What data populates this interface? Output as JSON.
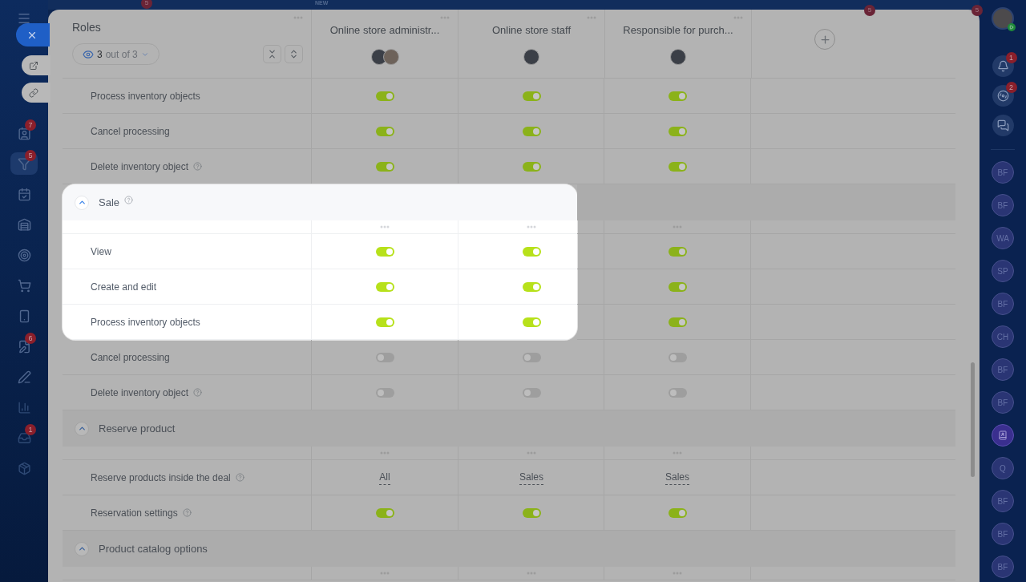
{
  "top_bar": {
    "left_badge": "5",
    "new_label": "NEW",
    "right_badges": [
      "5",
      "5"
    ]
  },
  "left_nav": {
    "items": [
      {
        "kind": "contacts",
        "badge": "7",
        "selected": false
      },
      {
        "kind": "funnel",
        "badge": "5",
        "selected": true
      },
      {
        "kind": "calendar",
        "selected": false
      },
      {
        "kind": "store",
        "selected": false
      },
      {
        "kind": "target",
        "selected": false
      },
      {
        "kind": "cart",
        "selected": false
      },
      {
        "kind": "device",
        "selected": false
      },
      {
        "kind": "document",
        "badge": "6",
        "selected": false
      },
      {
        "kind": "pen",
        "selected": false
      },
      {
        "kind": "chart",
        "selected": false
      },
      {
        "kind": "inbox",
        "badge": "1",
        "selected": false
      },
      {
        "kind": "box",
        "selected": false
      }
    ]
  },
  "right_sidebar": {
    "notifications_badge": "1",
    "activity_badge": "2",
    "contacts": [
      {
        "kind": "initials",
        "text": "BF"
      },
      {
        "kind": "initials",
        "text": "BF"
      },
      {
        "kind": "initials",
        "text": "WA"
      },
      {
        "kind": "initials",
        "text": "SP"
      },
      {
        "kind": "initials",
        "text": "BF"
      },
      {
        "kind": "initials",
        "text": "CH"
      },
      {
        "kind": "initials",
        "text": "BF"
      },
      {
        "kind": "initials",
        "text": "BF"
      },
      {
        "kind": "book"
      },
      {
        "kind": "initials",
        "text": "Q"
      },
      {
        "kind": "initials",
        "text": "BF"
      },
      {
        "kind": "initials",
        "text": "BF"
      },
      {
        "kind": "initials",
        "text": "BF"
      }
    ]
  },
  "roles_header": {
    "title": "Roles",
    "filter": {
      "shown": "3",
      "total": "out of 3"
    }
  },
  "roles": [
    {
      "name": "Online store administr...",
      "avatars": [
        {
          "kind": "photo"
        },
        {
          "kind": "photo"
        }
      ]
    },
    {
      "name": "Online store staff",
      "avatars": [
        {
          "kind": "photo"
        }
      ]
    },
    {
      "name": "Responsible for purch...",
      "avatars": [
        {
          "kind": "photo"
        }
      ]
    }
  ],
  "sections": [
    {
      "rows": [
        {
          "label": "Process inventory objects",
          "help": false,
          "highlighted": false,
          "cells": [
            {
              "kind": "toggle",
              "on": true
            },
            {
              "kind": "toggle",
              "on": true
            },
            {
              "kind": "toggle",
              "on": true
            }
          ]
        },
        {
          "label": "Cancel processing",
          "help": false,
          "highlighted": false,
          "cells": [
            {
              "kind": "toggle",
              "on": true
            },
            {
              "kind": "toggle",
              "on": true
            },
            {
              "kind": "toggle",
              "on": true
            }
          ]
        },
        {
          "label": "Delete inventory object",
          "help": true,
          "highlighted": false,
          "cells": [
            {
              "kind": "toggle",
              "on": true
            },
            {
              "kind": "toggle",
              "on": true
            },
            {
              "kind": "toggle",
              "on": true
            }
          ]
        }
      ]
    },
    {
      "title": "Sale",
      "help": true,
      "highlighted": true,
      "rows": [
        {
          "label": "View",
          "help": false,
          "highlighted": true,
          "cells": [
            {
              "kind": "toggle",
              "on": true
            },
            {
              "kind": "toggle",
              "on": true
            },
            {
              "kind": "toggle",
              "on": true
            }
          ]
        },
        {
          "label": "Create and edit",
          "help": false,
          "highlighted": true,
          "cells": [
            {
              "kind": "toggle",
              "on": true
            },
            {
              "kind": "toggle",
              "on": true
            },
            {
              "kind": "toggle",
              "on": true
            }
          ]
        },
        {
          "label": "Process inventory objects",
          "help": false,
          "highlighted": true,
          "cells": [
            {
              "kind": "toggle",
              "on": true
            },
            {
              "kind": "toggle",
              "on": true
            },
            {
              "kind": "toggle",
              "on": true
            }
          ]
        },
        {
          "label": "Cancel processing",
          "help": false,
          "highlighted": false,
          "cells": [
            {
              "kind": "toggle",
              "on": false
            },
            {
              "kind": "toggle",
              "on": false
            },
            {
              "kind": "toggle",
              "on": false
            }
          ]
        },
        {
          "label": "Delete inventory object",
          "help": true,
          "highlighted": false,
          "cells": [
            {
              "kind": "toggle",
              "on": false
            },
            {
              "kind": "toggle",
              "on": false
            },
            {
              "kind": "toggle",
              "on": false
            }
          ]
        }
      ]
    },
    {
      "title": "Reserve product",
      "help": false,
      "highlighted": false,
      "rows": [
        {
          "label": "Reserve products inside the deal",
          "help": true,
          "highlighted": false,
          "cells": [
            {
              "kind": "select",
              "value": "All"
            },
            {
              "kind": "select",
              "value": "Sales"
            },
            {
              "kind": "select",
              "value": "Sales"
            }
          ]
        },
        {
          "label": "Reservation settings",
          "help": true,
          "highlighted": false,
          "cells": [
            {
              "kind": "toggle",
              "on": true
            },
            {
              "kind": "toggle",
              "on": true
            },
            {
              "kind": "toggle",
              "on": true
            }
          ]
        }
      ]
    },
    {
      "title": "Product catalog options",
      "help": false,
      "highlighted": false
    }
  ]
}
